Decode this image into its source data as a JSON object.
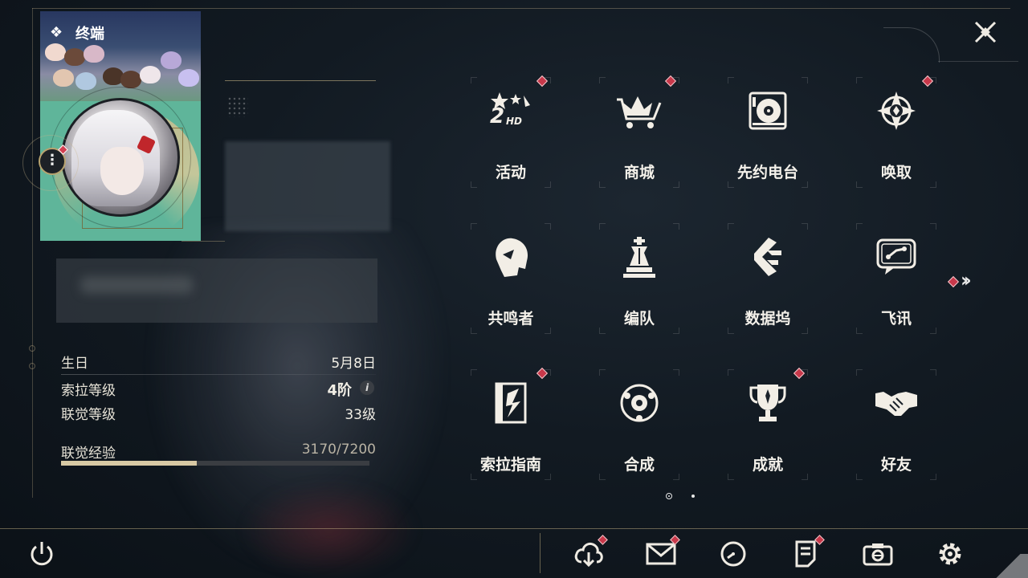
{
  "window": {
    "title": "终端"
  },
  "profile": {
    "birthday_label": "生日",
    "birthday_value": "5月8日",
    "sola_level_label": "索拉等级",
    "sola_level_value": "4阶",
    "union_level_label": "联觉等级",
    "union_level_value": "33级",
    "exp_label": "联觉经验",
    "exp_value": "3170/7200",
    "exp_progress": 0.44
  },
  "menu": {
    "page1": [
      {
        "label": "活动",
        "icon": "activity-2hd-icon",
        "badge": true
      },
      {
        "label": "商城",
        "icon": "shop-cart-icon",
        "badge": true
      },
      {
        "label": "先约电台",
        "icon": "radio-vinyl-icon",
        "badge": false
      },
      {
        "label": "唤取",
        "icon": "summon-compass-icon",
        "badge": true
      },
      {
        "label": "共鸣者",
        "icon": "resonator-head-icon",
        "badge": false
      },
      {
        "label": "编队",
        "icon": "chess-team-icon",
        "badge": false
      },
      {
        "label": "数据坞",
        "icon": "data-bank-icon",
        "badge": false
      },
      {
        "label": "飞讯",
        "icon": "message-chat-icon",
        "badge": false
      },
      {
        "label": "索拉指南",
        "icon": "guidebook-icon",
        "badge": true
      },
      {
        "label": "合成",
        "icon": "synthesis-icon",
        "badge": false
      },
      {
        "label": "成就",
        "icon": "trophy-icon",
        "badge": true
      },
      {
        "label": "好友",
        "icon": "handshake-icon",
        "badge": false
      }
    ]
  },
  "pagination": {
    "current": 1,
    "total": 2
  },
  "bottom_bar": {
    "items": [
      {
        "name": "download-icon",
        "badge": true
      },
      {
        "name": "mail-icon",
        "badge": true
      },
      {
        "name": "clock-icon",
        "badge": false
      },
      {
        "name": "notice-icon",
        "badge": true
      },
      {
        "name": "camera-icon",
        "badge": false
      },
      {
        "name": "settings-gear-icon",
        "badge": false
      }
    ]
  },
  "colors": {
    "accent_gold": "#d8c9a4",
    "badge_red": "#c8384a",
    "background": "#121a22"
  }
}
